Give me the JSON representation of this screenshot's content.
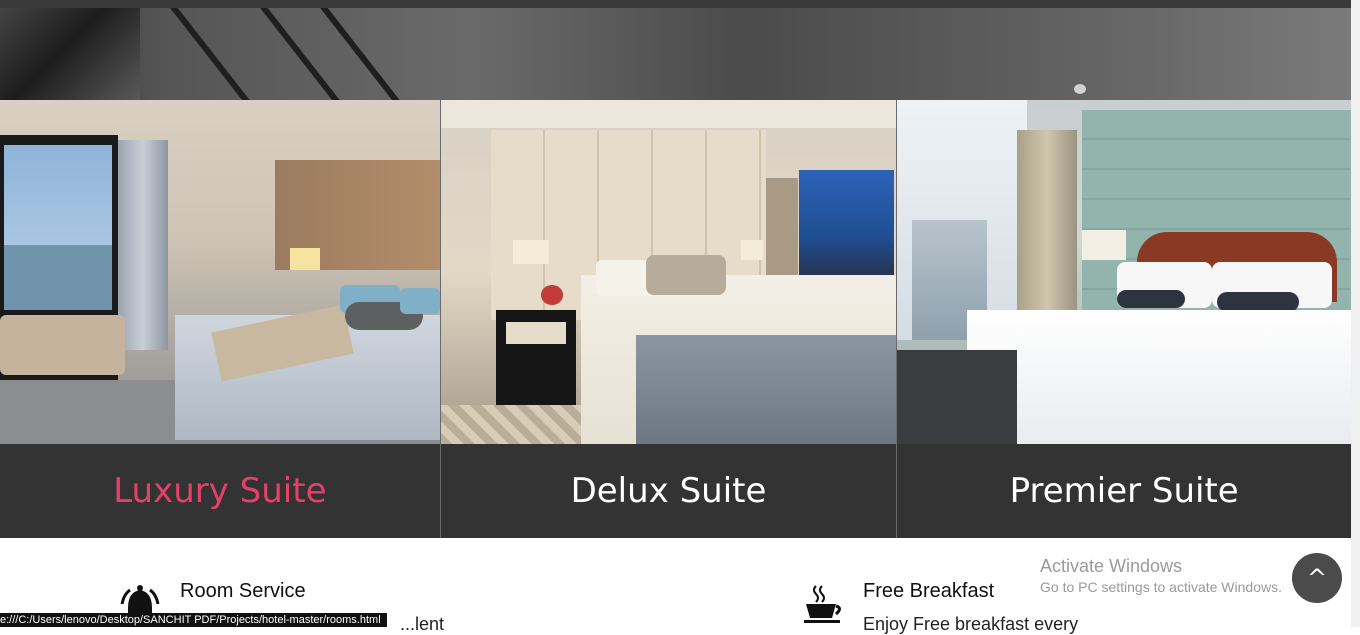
{
  "rooms": [
    {
      "label": "Luxury Suite",
      "active": true
    },
    {
      "label": "Delux Suite",
      "active": false
    },
    {
      "label": "Premier Suite",
      "active": false
    }
  ],
  "features": [
    {
      "title": "Room Service",
      "desc_partial": "...lent",
      "icon": "bell-icon"
    },
    {
      "title": "Free Breakfast",
      "desc_partial": "Enjoy Free breakfast every",
      "icon": "coffee-cup-icon"
    }
  ],
  "watermark": {
    "line1": "Activate Windows",
    "line2": "Go to PC settings to activate Windows."
  },
  "back_to_top": {
    "label": "^"
  },
  "status_bar": {
    "url": "e:///C:/Users/lenovo/Desktop/SANCHIT PDF/Projects/hotel-master/rooms.html"
  },
  "colors": {
    "active_label": "#e4416a",
    "label_bg": "#333333",
    "accent_dark": "#3a3a3a"
  }
}
